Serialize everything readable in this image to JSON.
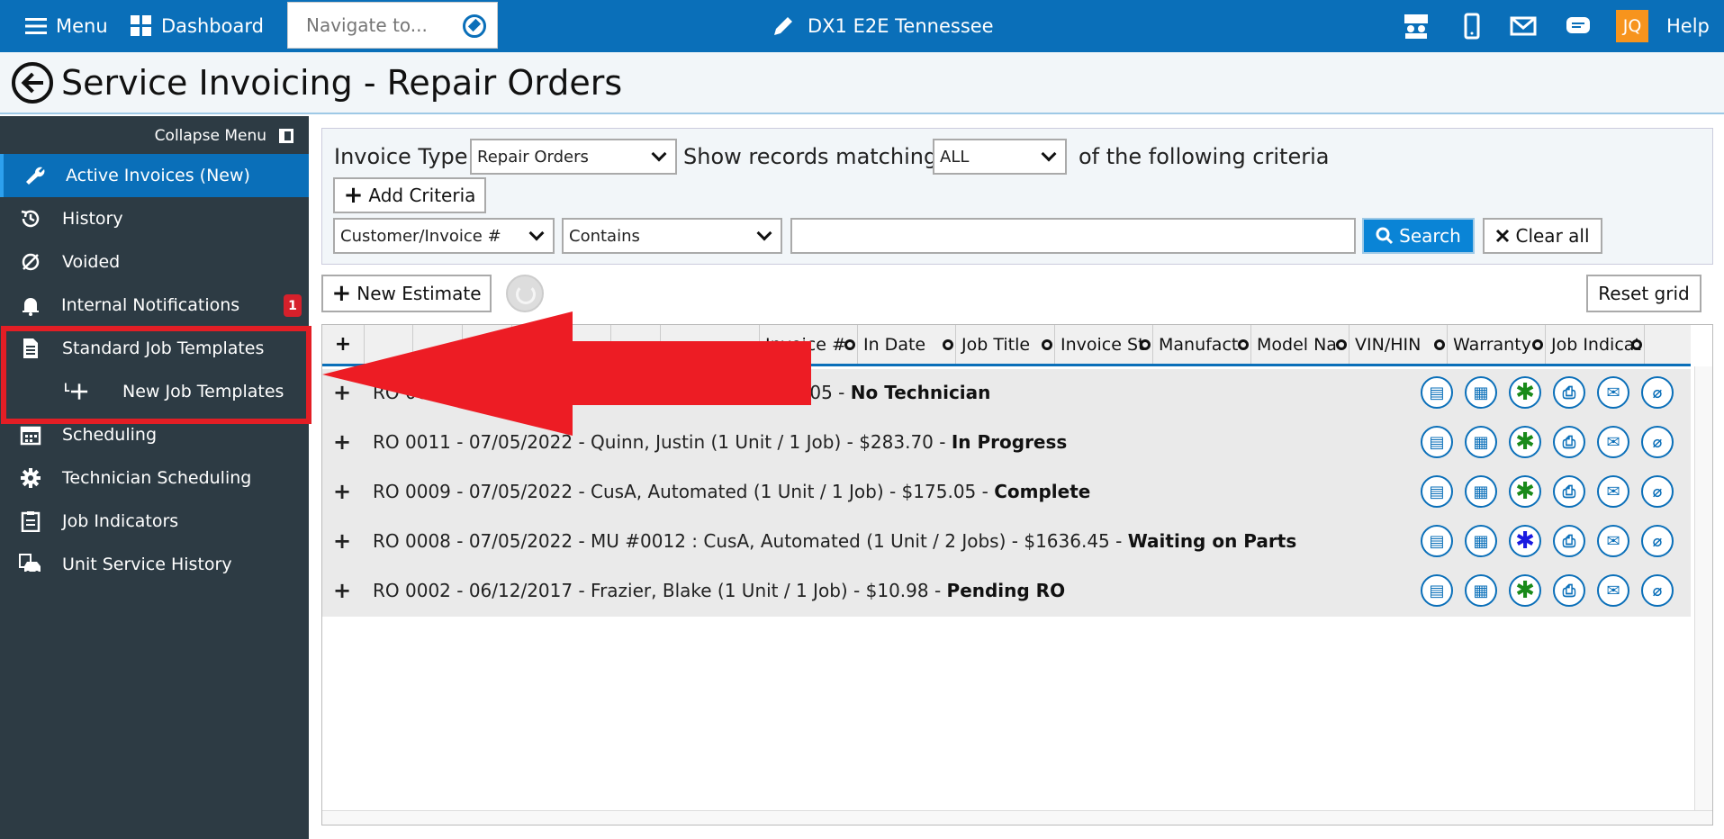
{
  "topbar": {
    "menu_label": "Menu",
    "dashboard_label": "Dashboard",
    "navigate_placeholder": "Navigate to...",
    "company_name": "DX1 E2E Tennessee",
    "user_initials": "JQ",
    "help_label": "Help"
  },
  "page": {
    "title": "Service Invoicing - Repair Orders"
  },
  "sidebar": {
    "collapse_label": "Collapse Menu",
    "items": [
      {
        "label": "Active Invoices (New)",
        "icon": "wrench-icon"
      },
      {
        "label": "History",
        "icon": "history-icon"
      },
      {
        "label": "Voided",
        "icon": "void-icon"
      },
      {
        "label": "Internal Notifications",
        "icon": "bell-icon",
        "badge": "1"
      },
      {
        "label": "Standard Job Templates",
        "icon": "document-icon"
      },
      {
        "label": "New Job Templates",
        "icon": "plus-icon"
      },
      {
        "label": "Scheduling",
        "icon": "calendar-icon"
      },
      {
        "label": "Technician Scheduling",
        "icon": "gear-icon"
      },
      {
        "label": "Job Indicators",
        "icon": "clipboard-icon"
      },
      {
        "label": "Unit Service History",
        "icon": "car-icon"
      }
    ]
  },
  "filter": {
    "invoice_type_label": "Invoice Type",
    "invoice_type_value": "Repair Orders",
    "show_records_label": "Show records matching",
    "match_value": "ALL",
    "criteria_label": "of the following criteria",
    "add_criteria_label": "Add Criteria",
    "field_value": "Customer/Invoice #",
    "operator_value": "Contains",
    "search_value": "",
    "search_label": "Search",
    "clear_label": "Clear all"
  },
  "toolbar": {
    "new_estimate_label": "New Estimate",
    "reset_grid_label": "Reset grid"
  },
  "grid": {
    "columns": [
      "+",
      "",
      "",
      "",
      "",
      "",
      "",
      "",
      "Invoice #",
      "In Date",
      "Job Title",
      "Invoice St",
      "Manufact",
      "Model Na",
      "VIN/HIN",
      "Warranty",
      "Job Indicat"
    ],
    "rows": [
      {
        "prefix": "RO 00",
        "rest": "ob)  -  $218.05  -  ",
        "status": "No Technician",
        "warranty_color": "green"
      },
      {
        "prefix": "RO 0011  -  07/05/2022  -  Quinn, Justin (1 Unit / 1 Job)  -  $283.70  -  ",
        "rest": "",
        "status": "In Progress",
        "warranty_color": "green"
      },
      {
        "prefix": "RO 0009  -  07/05/2022  -  CusA, Automated (1 Unit / 1 Job)  -  $175.05  -  ",
        "rest": "",
        "status": "Complete",
        "warranty_color": "green"
      },
      {
        "prefix": "RO 0008  -  07/05/2022  -  MU #0012 : CusA, Automated (1 Unit / 2 Jobs)  -  $1636.45  -  ",
        "rest": "",
        "status": "Waiting on Parts",
        "warranty_color": "blue"
      },
      {
        "prefix": "RO 0002  -  06/12/2017  -  Frazier, Blake (1 Unit / 1 Job)  -  $10.98  -  ",
        "rest": "",
        "status": "Pending RO",
        "warranty_color": "green"
      }
    ]
  },
  "colors": {
    "brand_blue": "#0a6fb9",
    "sidebar_bg": "#2d3b44",
    "highlight_red": "#e31e25",
    "badge_red": "#d6202b",
    "user_orange": "#f7941d"
  }
}
